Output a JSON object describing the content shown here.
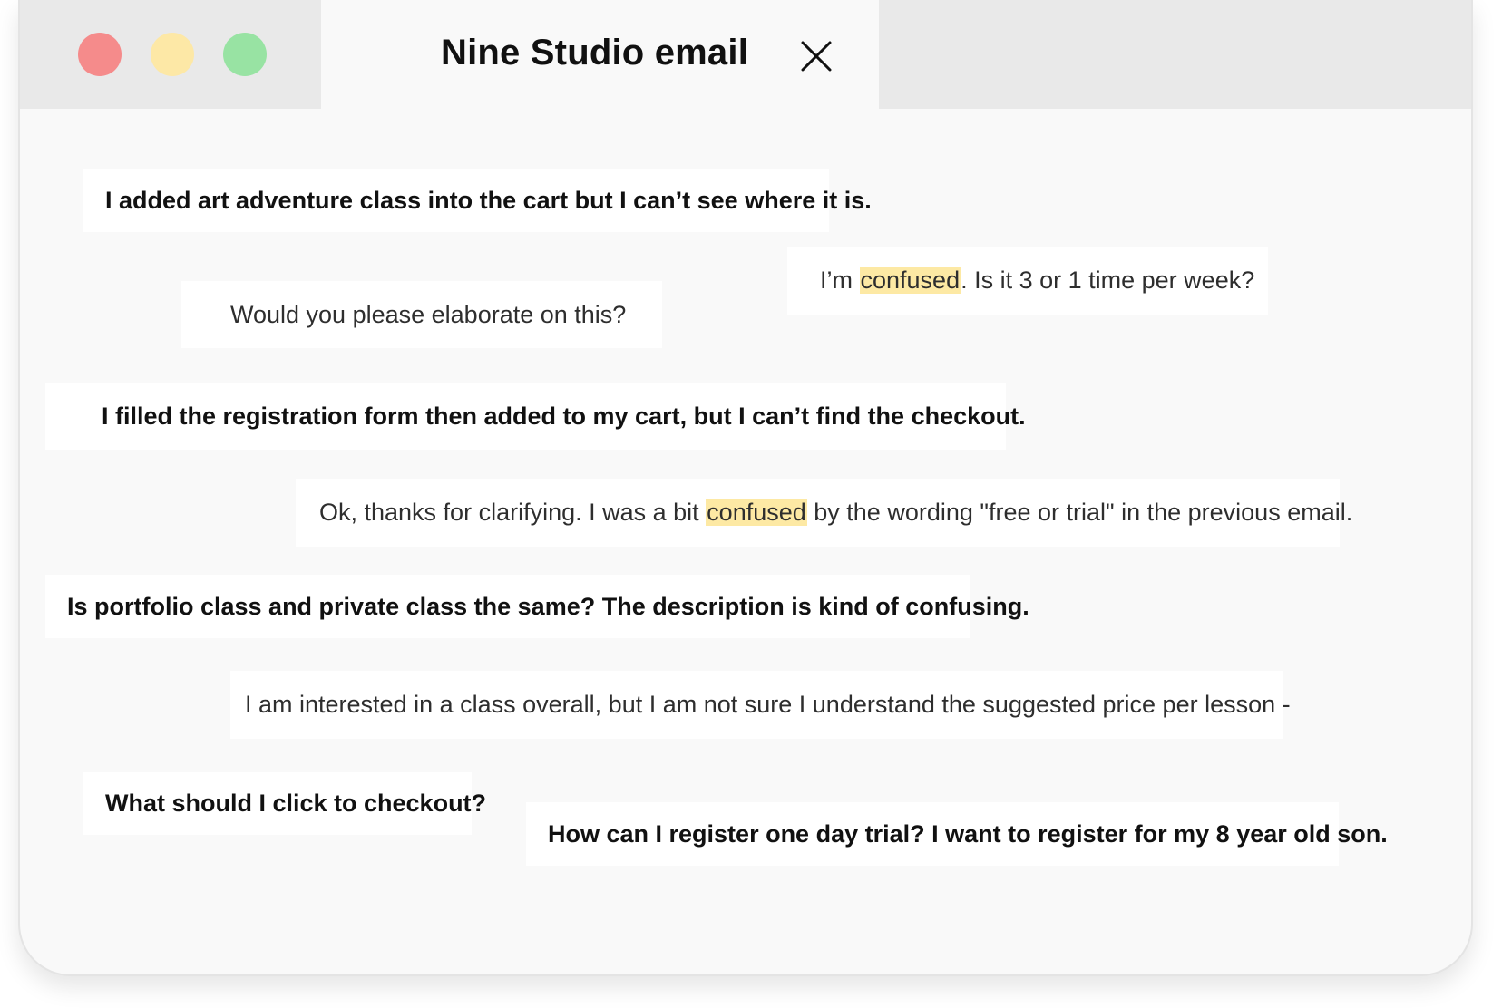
{
  "window": {
    "title": "Nine Studio email",
    "traffic_lights": [
      {
        "name": "close",
        "color": "#f58b8b"
      },
      {
        "name": "minimize",
        "color": "#fde8a6"
      },
      {
        "name": "maximize",
        "color": "#98e3a3"
      }
    ],
    "close_icon": "close-x-icon"
  },
  "colors": {
    "highlight": "#fde9a4",
    "card": "#ffffff",
    "canvas": "#f9f9f9"
  },
  "messages": [
    {
      "id": "m1",
      "text": "I added art adventure class into the cart but I can’t see where it is."
    },
    {
      "id": "m2",
      "before": "I’m ",
      "highlight": "confused",
      "after": ". Is it 3 or 1 time per week?"
    },
    {
      "id": "m3",
      "text": "Would you please elaborate on this?"
    },
    {
      "id": "m4",
      "text": "I filled the registration form then added to my cart, but I can’t find the checkout."
    },
    {
      "id": "m5",
      "before": "Ok, thanks for clarifying. I was a bit ",
      "highlight": "confused",
      "after": " by the wording \"free or trial\" in the previous email."
    },
    {
      "id": "m6",
      "text": "Is portfolio class and private class the same? The description is kind of confusing."
    },
    {
      "id": "m7",
      "text": "I am interested in a class overall, but I am not sure I understand the suggested price per lesson -"
    },
    {
      "id": "m8",
      "text": "What should I click to checkout?"
    },
    {
      "id": "m9",
      "text": "How can I register one day trial? I want to register for my 8 year old son."
    }
  ]
}
